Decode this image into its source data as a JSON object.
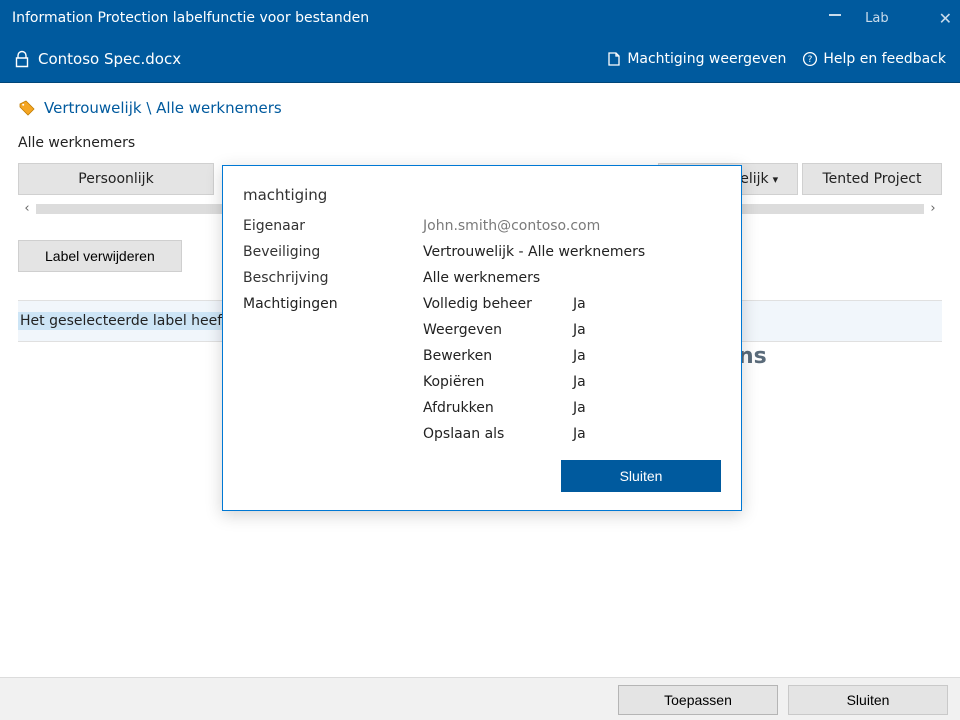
{
  "titlebar": {
    "title": "Information Protection labelfunctie voor bestanden",
    "lab": "Lab"
  },
  "header": {
    "filename": "Contoso Spec.docx",
    "show_permissions": "Machtiging weergeven",
    "help_feedback": "Help en feedback"
  },
  "breadcrumb": "Vertrouwelijk \\ Alle werknemers",
  "selected_label_heading": "Alle werknemers",
  "label_buttons": {
    "personal": "Persoonlijk",
    "confidential": "vertrouwelijk",
    "dropdown_marker": "▾",
    "tented": "Tented Project"
  },
  "remove_label": "Label verwijderen",
  "description_prefix": "Het geselecteerde label heeft al",
  "description_tail": "ns",
  "modal": {
    "title": "machtiging",
    "owner_label": "Eigenaar",
    "owner_value": "John.smith@contoso.com",
    "security_label": "Beveiliging",
    "security_value": "Vertrouwelijk - Alle werknemers",
    "desc_label": "Beschrijving",
    "desc_value": "Alle werknemers",
    "perms_label": "Machtigingen",
    "perms": [
      {
        "name": "Volledig beheer",
        "val": "Ja"
      },
      {
        "name": "Weergeven",
        "val": "Ja"
      },
      {
        "name": "Bewerken",
        "val": "Ja"
      },
      {
        "name": "Kopiëren",
        "val": "Ja"
      },
      {
        "name": "Afdrukken",
        "val": "Ja"
      },
      {
        "name": "Opslaan als",
        "val": "Ja"
      }
    ],
    "close": "Sluiten"
  },
  "footer": {
    "apply": "Toepassen",
    "close": "Sluiten"
  }
}
